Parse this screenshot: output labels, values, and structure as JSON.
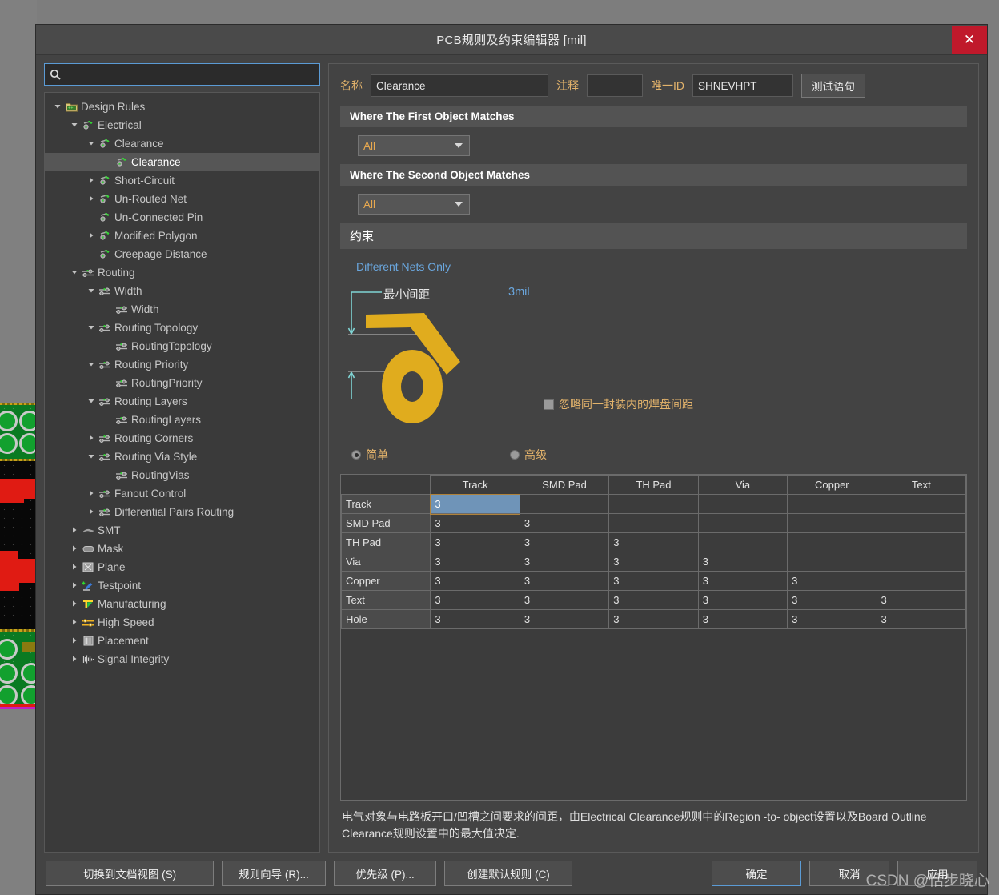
{
  "window": {
    "title": "PCB规则及约束编辑器 [mil]",
    "close_label": "✕"
  },
  "search": {
    "value": "",
    "placeholder": "",
    "icon": "search-icon"
  },
  "tree": {
    "items": [
      {
        "label": "Design Rules",
        "depth": 0,
        "twisty": "open",
        "icon": "folder-rules-icon",
        "selected": false
      },
      {
        "label": "Electrical",
        "depth": 1,
        "twisty": "open",
        "icon": "electrical-icon",
        "selected": false
      },
      {
        "label": "Clearance",
        "depth": 2,
        "twisty": "open",
        "icon": "electrical-icon",
        "selected": false
      },
      {
        "label": "Clearance",
        "depth": 3,
        "twisty": "none",
        "icon": "electrical-icon",
        "selected": true
      },
      {
        "label": "Short-Circuit",
        "depth": 2,
        "twisty": "closed",
        "icon": "electrical-icon",
        "selected": false
      },
      {
        "label": "Un-Routed Net",
        "depth": 2,
        "twisty": "closed",
        "icon": "electrical-icon",
        "selected": false
      },
      {
        "label": "Un-Connected Pin",
        "depth": 2,
        "twisty": "none",
        "icon": "electrical-icon",
        "selected": false
      },
      {
        "label": "Modified Polygon",
        "depth": 2,
        "twisty": "closed",
        "icon": "electrical-icon",
        "selected": false
      },
      {
        "label": "Creepage Distance",
        "depth": 2,
        "twisty": "none",
        "icon": "electrical-icon",
        "selected": false
      },
      {
        "label": "Routing",
        "depth": 1,
        "twisty": "open",
        "icon": "routing-icon",
        "selected": false
      },
      {
        "label": "Width",
        "depth": 2,
        "twisty": "open",
        "icon": "routing-icon",
        "selected": false
      },
      {
        "label": "Width",
        "depth": 3,
        "twisty": "none",
        "icon": "routing-icon",
        "selected": false
      },
      {
        "label": "Routing Topology",
        "depth": 2,
        "twisty": "open",
        "icon": "routing-icon",
        "selected": false
      },
      {
        "label": "RoutingTopology",
        "depth": 3,
        "twisty": "none",
        "icon": "routing-icon",
        "selected": false
      },
      {
        "label": "Routing Priority",
        "depth": 2,
        "twisty": "open",
        "icon": "routing-icon",
        "selected": false
      },
      {
        "label": "RoutingPriority",
        "depth": 3,
        "twisty": "none",
        "icon": "routing-icon",
        "selected": false
      },
      {
        "label": "Routing Layers",
        "depth": 2,
        "twisty": "open",
        "icon": "routing-icon",
        "selected": false
      },
      {
        "label": "RoutingLayers",
        "depth": 3,
        "twisty": "none",
        "icon": "routing-icon",
        "selected": false
      },
      {
        "label": "Routing Corners",
        "depth": 2,
        "twisty": "closed",
        "icon": "routing-icon",
        "selected": false
      },
      {
        "label": "Routing Via Style",
        "depth": 2,
        "twisty": "open",
        "icon": "routing-icon",
        "selected": false
      },
      {
        "label": "RoutingVias",
        "depth": 3,
        "twisty": "none",
        "icon": "routing-icon",
        "selected": false
      },
      {
        "label": "Fanout Control",
        "depth": 2,
        "twisty": "closed",
        "icon": "routing-icon",
        "selected": false
      },
      {
        "label": "Differential Pairs Routing",
        "depth": 2,
        "twisty": "closed",
        "icon": "routing-icon",
        "selected": false
      },
      {
        "label": "SMT",
        "depth": 1,
        "twisty": "closed",
        "icon": "smt-icon",
        "selected": false
      },
      {
        "label": "Mask",
        "depth": 1,
        "twisty": "closed",
        "icon": "mask-icon",
        "selected": false
      },
      {
        "label": "Plane",
        "depth": 1,
        "twisty": "closed",
        "icon": "plane-icon",
        "selected": false
      },
      {
        "label": "Testpoint",
        "depth": 1,
        "twisty": "closed",
        "icon": "testpoint-icon",
        "selected": false
      },
      {
        "label": "Manufacturing",
        "depth": 1,
        "twisty": "closed",
        "icon": "manufacturing-icon",
        "selected": false
      },
      {
        "label": "High Speed",
        "depth": 1,
        "twisty": "closed",
        "icon": "highspeed-icon",
        "selected": false
      },
      {
        "label": "Placement",
        "depth": 1,
        "twisty": "closed",
        "icon": "placement-icon",
        "selected": false
      },
      {
        "label": "Signal Integrity",
        "depth": 1,
        "twisty": "closed",
        "icon": "signalintegrity-icon",
        "selected": false
      }
    ]
  },
  "rule_header": {
    "name_label": "名称",
    "name_value": "Clearance",
    "comment_label": "注释",
    "comment_value": "",
    "uid_label": "唯一ID",
    "uid_value": "SHNEVHPT",
    "test_button": "测试语句"
  },
  "first_object": {
    "section_title": "Where The First Object Matches",
    "scope_value": "All"
  },
  "second_object": {
    "section_title": "Where The Second Object Matches",
    "scope_value": "All"
  },
  "constraints": {
    "section_title": "约束",
    "different_nets_only": "Different Nets Only",
    "min_clearance_label": "最小间距",
    "min_clearance_value": "3mil",
    "ignore_pad_label": "忽略同一封装内的焊盘间距",
    "ignore_pad_checked": false,
    "mode_simple": "简单",
    "mode_advanced": "高级",
    "mode_selected": "简单"
  },
  "matrix": {
    "columns": [
      "Track",
      "SMD Pad",
      "TH Pad",
      "Via",
      "Copper",
      "Text"
    ],
    "rows": [
      {
        "label": "Track",
        "values": [
          "3"
        ]
      },
      {
        "label": "SMD Pad",
        "values": [
          "3",
          "3"
        ]
      },
      {
        "label": "TH Pad",
        "values": [
          "3",
          "3",
          "3"
        ]
      },
      {
        "label": "Via",
        "values": [
          "3",
          "3",
          "3",
          "3"
        ]
      },
      {
        "label": "Copper",
        "values": [
          "3",
          "3",
          "3",
          "3",
          "3"
        ]
      },
      {
        "label": "Text",
        "values": [
          "3",
          "3",
          "3",
          "3",
          "3",
          "3"
        ]
      },
      {
        "label": "Hole",
        "values": [
          "3",
          "3",
          "3",
          "3",
          "3",
          "3"
        ]
      }
    ],
    "selected_cell": {
      "row": 0,
      "col": 0
    }
  },
  "description": "电气对象与电路板开口/凹槽之间要求的间距，由Electrical Clearance规则中的Region -to- object设置以及Board Outline Clearance规则设置中的最大值决定.",
  "footer": {
    "switch_doc_view": "切换到文档视图 (S)",
    "rule_wizard": "规则向导 (R)...",
    "priority": "优先级 (P)...",
    "create_defaults": "创建默认规则 (C)",
    "ok": "确定",
    "cancel": "取消",
    "apply": "应用"
  },
  "watermark": "CSDN @恬步晓心",
  "colors": {
    "accent_blue": "#6aa6dd",
    "label_orange": "#e3b36b",
    "trace_yellow": "#e0ac1e",
    "selection_blue": "#6f94b8",
    "close_red": "#c0192b",
    "pcb_green": "#0a7a22",
    "pcb_red": "#e01b13"
  }
}
